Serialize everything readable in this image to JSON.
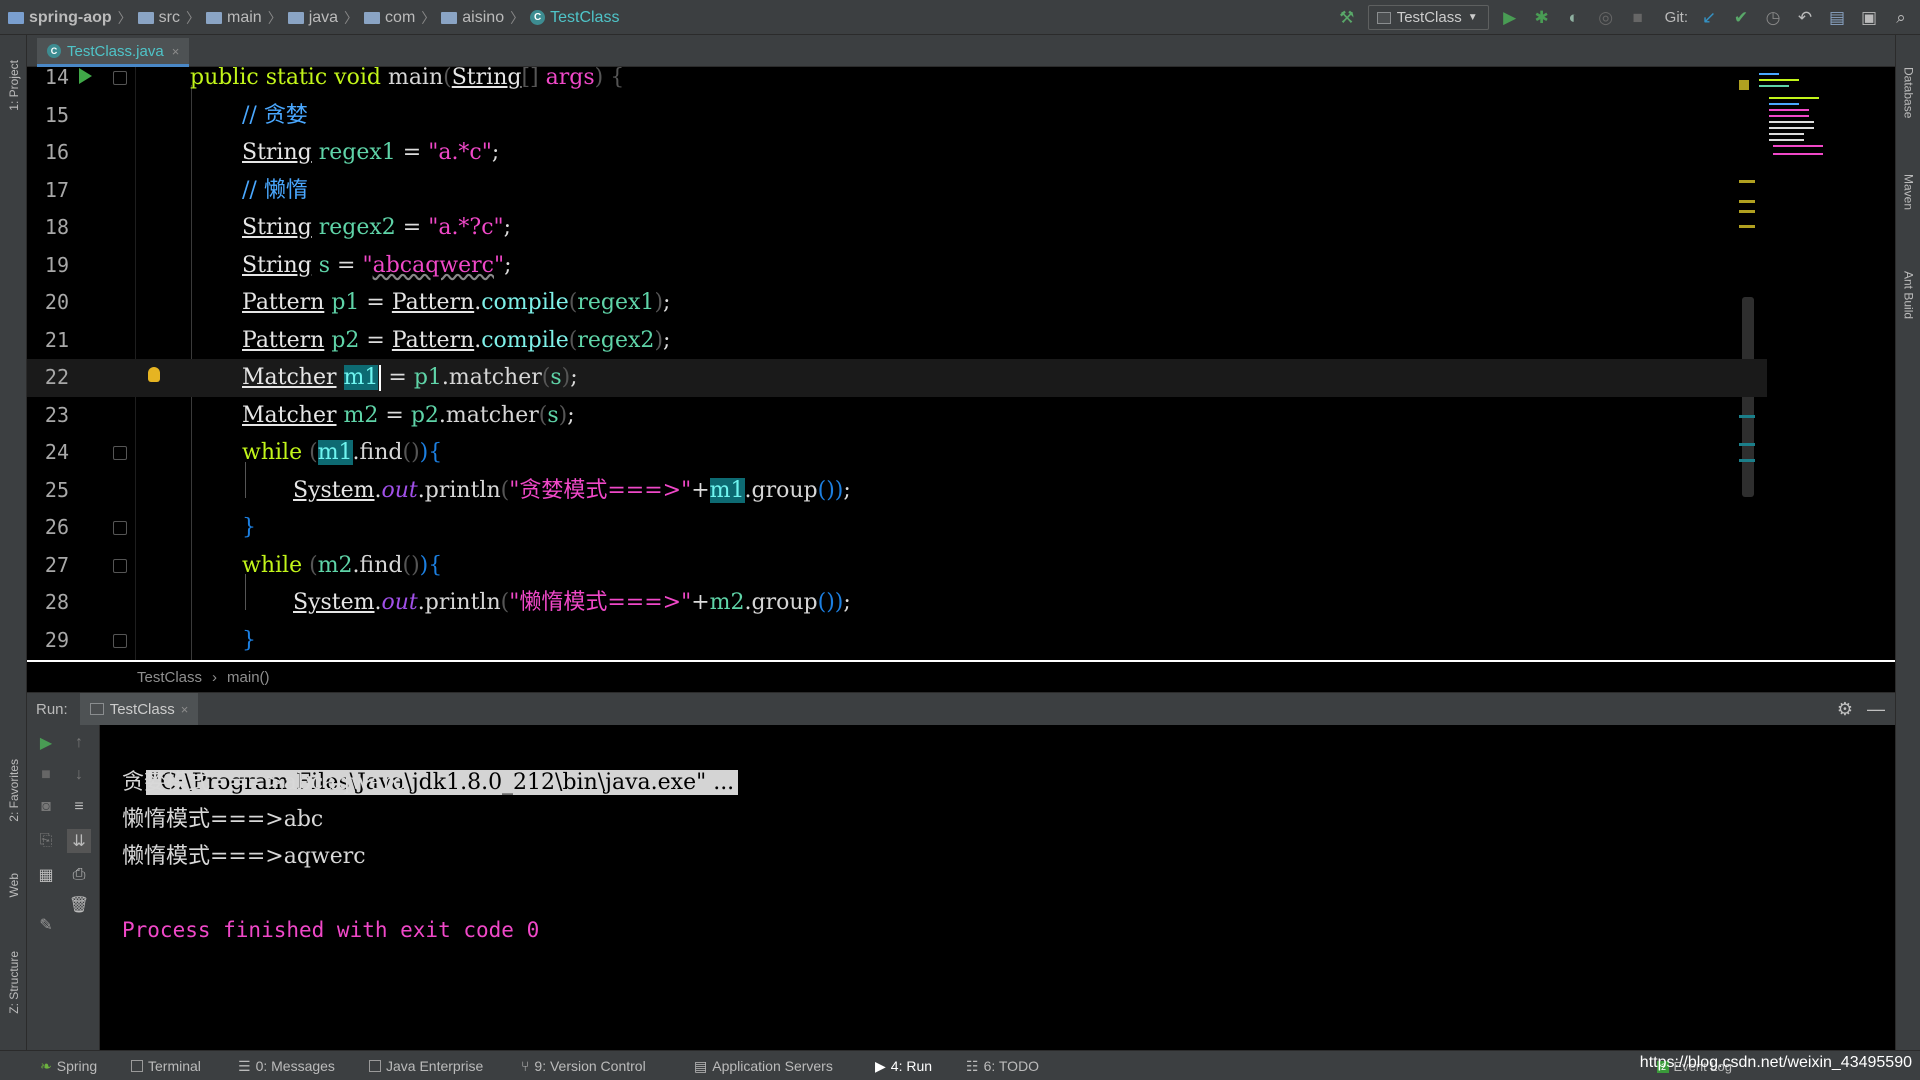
{
  "breadcrumbs": [
    {
      "label": "spring-aop",
      "kind": "project"
    },
    {
      "label": "src",
      "kind": "folder"
    },
    {
      "label": "main",
      "kind": "folder"
    },
    {
      "label": "java",
      "kind": "folder"
    },
    {
      "label": "com",
      "kind": "folder"
    },
    {
      "label": "aisino",
      "kind": "folder"
    },
    {
      "label": "TestClass",
      "kind": "class"
    }
  ],
  "toolbar": {
    "run_config": "TestClass",
    "git_label": "Git:"
  },
  "left_stripe": {
    "project": "1: Project",
    "favorites": "2: Favorites",
    "web": "Web",
    "structure": "Z: Structure"
  },
  "right_stripe": {
    "database": "Database",
    "maven": "Maven",
    "ant": "Ant Build"
  },
  "editor_tab": {
    "label": "TestClass.java",
    "close": "×"
  },
  "editor": {
    "line_numbers": [
      "14",
      "15",
      "16",
      "17",
      "18",
      "19",
      "20",
      "21",
      "22",
      "23",
      "24",
      "25",
      "26",
      "27",
      "28",
      "29"
    ],
    "current_line": "22"
  },
  "editor_breadcrumb": {
    "class": "TestClass",
    "method": "main()",
    "sep": "›"
  },
  "run_panel": {
    "label": "Run:",
    "tab": "TestClass",
    "close": "×"
  },
  "console": {
    "command": "\"C:\\Program Files\\Java\\jdk1.8.0_212\\bin\\java.exe\" ...",
    "output": [
      "贪婪模式===>abcaqwerc",
      "懒惰模式===>abc",
      "懒惰模式===>aqwerc"
    ],
    "exit_message": "Process finished with exit code 0"
  },
  "status_bar": {
    "tabs": [
      {
        "label": "Spring",
        "active": false
      },
      {
        "label": "Terminal",
        "active": false
      },
      {
        "label": "0: Messages",
        "active": false
      },
      {
        "label": "Java Enterprise",
        "active": false
      },
      {
        "label": "9: Version Control",
        "active": false
      },
      {
        "label": "Application Servers",
        "active": false
      },
      {
        "label": "4: Run",
        "active": true
      },
      {
        "label": "6: TODO",
        "active": false
      }
    ],
    "event_log": "Event Log",
    "event_badge": "2",
    "watermark": "https://blog.csdn.net/weixin_43495590"
  },
  "colors": {
    "keyword": "#c2f51a",
    "string": "#f048c8",
    "comment": "#4aa8ff",
    "variable": "#5fd4a8",
    "background": "#000000",
    "chrome": "#3c3f41"
  }
}
